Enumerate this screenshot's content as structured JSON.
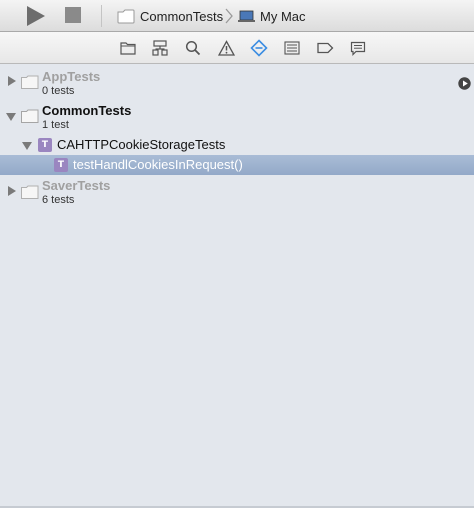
{
  "toolbar": {
    "scheme_label": "CommonTests",
    "destination_label": "My Mac"
  },
  "navigator": {
    "icons": [
      "folder-icon",
      "hierarchy-icon",
      "search-icon",
      "warning-icon",
      "test-diamond-icon",
      "list-icon",
      "breakpoint-tag-icon",
      "log-icon"
    ],
    "selected": "test-diamond-icon",
    "accent": "#3b8de2"
  },
  "tests": {
    "targets": [
      {
        "name": "AppTests",
        "count": "0 tests",
        "expanded": false,
        "dimmed": true
      },
      {
        "name": "CommonTests",
        "count": "1 test",
        "expanded": true,
        "dimmed": false,
        "classes": [
          {
            "badge": "T",
            "name": "CAHTTPCookieStorageTests",
            "methods": [
              {
                "badge": "T",
                "name": "testHandlCookiesInRequest()",
                "selected": true
              }
            ]
          }
        ]
      },
      {
        "name": "SaverTests",
        "count": "6 tests",
        "expanded": false,
        "dimmed": true
      }
    ]
  },
  "colors": {
    "selection": "#9db1ce",
    "badge": "#9a86c0",
    "background": "#e3e7ed"
  }
}
